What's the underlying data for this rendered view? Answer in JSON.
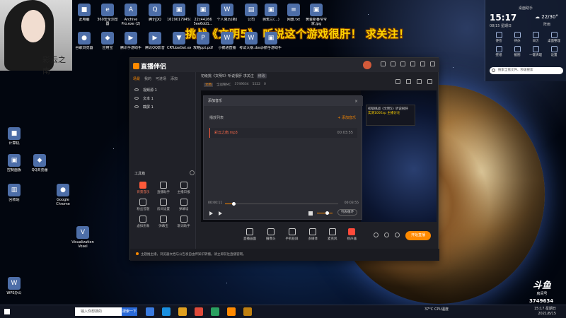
{
  "banner": "挑战《文明5》 听说这个游戏很肝！ 求关注！",
  "portrait_caption": "彩云之南",
  "desktop_icons": [
    {
      "label": "此电脑",
      "glyph": "■"
    },
    {
      "label": "360安全浏览器",
      "glyph": "e"
    },
    {
      "label": "Archive Pro.exe (2)",
      "glyph": "A"
    },
    {
      "label": "腾讯QQ",
      "glyph": "Q"
    },
    {
      "label": "1619017945(1).jpg",
      "glyph": "▣"
    },
    {
      "label": "22c44266 5ee6dd1...",
      "glyph": "▣"
    },
    {
      "label": "个人简历(新)",
      "glyph": "W"
    },
    {
      "label": "公司",
      "glyph": "▤"
    },
    {
      "label": "芭蕉兰(...)",
      "glyph": "▣"
    },
    {
      "label": "网盘.txt",
      "glyph": "≡"
    },
    {
      "label": "黄金新番爷爷家.jpg",
      "glyph": "▣"
    },
    {
      "label": "谷歌浏览器",
      "glyph": "●"
    },
    {
      "label": "应用宝",
      "glyph": "◆"
    },
    {
      "label": "腾讯手游助手",
      "glyph": "▶"
    },
    {
      "label": "腾讯QQ影音",
      "glyph": "▶"
    },
    {
      "label": "CRTubeGet.exe",
      "glyph": "▼"
    },
    {
      "label": "攻略ppt.pdf",
      "glyph": "P"
    },
    {
      "label": "小鹅通直播",
      "glyph": "W"
    },
    {
      "label": "考试大纲.docx",
      "glyph": "W"
    },
    {
      "label": "小鹅手游助手",
      "glyph": "▣"
    },
    {
      "label": "计算机",
      "glyph": "■"
    },
    {
      "label": "控制面板",
      "glyph": "▣"
    },
    {
      "label": "QQ浏览器",
      "glyph": "◆"
    },
    {
      "label": "回收站",
      "glyph": "▥"
    },
    {
      "label": "WPS办公",
      "glyph": "W"
    },
    {
      "label": "Google Chrome",
      "glyph": "●"
    },
    {
      "label": "Visualization Voxel",
      "glyph": "V"
    }
  ],
  "widget": {
    "title": "桌面助手",
    "time": "15:17",
    "date": "08/15 星期日",
    "weather": "22/30°",
    "weather_sub": "阵雨",
    "shortcuts": [
      "便签",
      "待办",
      "日历",
      "桌面整理",
      "壁纸",
      "截图",
      "一键清理",
      "设置"
    ],
    "search_placeholder": "搜索全盘文件、秒级搜索"
  },
  "app": {
    "logo": "直播伴侣",
    "sidebar_tabs": [
      "场景",
      "我的",
      "可进场",
      "添加"
    ],
    "sidebar_active": "场景",
    "scenes": [
      "视频源 1",
      "文本 1",
      "截屏 1"
    ],
    "tools_title": "工具箱",
    "tools": [
      {
        "label": "背景音乐",
        "hot": true
      },
      {
        "label": "直播助手",
        "hot": false
      },
      {
        "label": "主播日报",
        "hot": false
      },
      {
        "label": "粉丝答题",
        "hot": false
      },
      {
        "label": "房间设置",
        "hot": false
      },
      {
        "label": "弹幕墙",
        "hot": false
      },
      {
        "label": "虚拟形象",
        "hot": false
      },
      {
        "label": "弹幕宝",
        "hot": false
      },
      {
        "label": "歌词助手",
        "hot": false
      }
    ],
    "stream_title": "初级挑《文明5》听说很肝 求关注",
    "stream_tag": "修改",
    "meta": [
      "文档",
      "全战略MC",
      "3749634",
      "5222",
      "0"
    ],
    "preview_banner": "初级挑战《文明5》听说很肝",
    "preview_sub": "实测100Exp 主播讨论",
    "dialog": {
      "title": "添加音乐",
      "list_header": "播放列表",
      "add_label": "+ 添加音乐",
      "track_name": "彩云之南.mp3",
      "track_duration": "00:03:55",
      "time_current": "00:00:11",
      "time_total": "00:03:55",
      "loop_label": "列表循环",
      "progress_fraction": 0.06
    },
    "bottom_buttons": [
      "直播画面",
      "摄像头",
      "手机投屏",
      "多媒体",
      "麦克风",
      "扬声器"
    ],
    "go_live": "开始直播",
    "notice": "主题推主播，浏览器文档与公告发自由传知识转播。请立即前往直播官网。"
  },
  "taskbar": {
    "search_placeholder": "输入你想搜的",
    "search_button": "搜索一下",
    "tray_temp": "37°C CPU温度",
    "clock_time": "15:17 星期日",
    "clock_date": "2021/8/15"
  },
  "overlay": {
    "douyu": "斗鱼",
    "douyu_sub": "房间号",
    "room": "3749634"
  }
}
